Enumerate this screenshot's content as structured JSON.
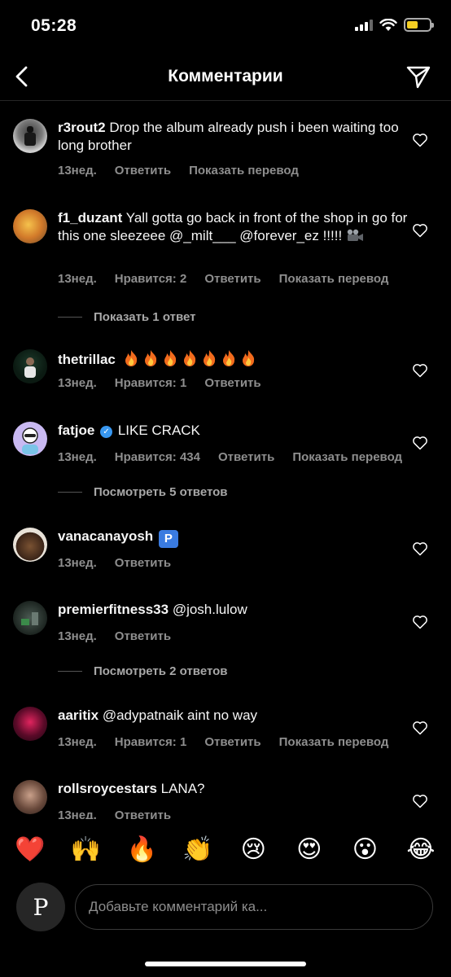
{
  "status": {
    "time": "05:28"
  },
  "header": {
    "title": "Комментарии"
  },
  "comments": [
    {
      "username": "r3rout2",
      "text": "Drop the album already push i been waiting too long brother",
      "time": "13нед.",
      "likes": "",
      "reply": "Ответить",
      "translate": "Показать перевод"
    },
    {
      "username": "f1_duzant",
      "text": "Yall gotta go back in front of the shop in go for this one sleezeee @_milt___ @forever_ez !!!!!",
      "time": "13нед.",
      "likes": "Нравится: 2",
      "reply": "Ответить",
      "translate": "Показать перевод",
      "replies_label": "Показать 1 ответ"
    },
    {
      "username": "thetrillac",
      "text": "",
      "time": "13нед.",
      "likes": "Нравится: 1",
      "reply": "Ответить",
      "translate": ""
    },
    {
      "username": "fatjoe",
      "text": "LIKE CRACK",
      "time": "13нед.",
      "likes": "Нравится: 434",
      "reply": "Ответить",
      "translate": "Показать перевод",
      "replies_label": "Посмотреть 5 ответов"
    },
    {
      "username": "vanacanayosh",
      "text": "",
      "time": "13нед.",
      "likes": "",
      "reply": "Ответить",
      "translate": ""
    },
    {
      "username": "premierfitness33",
      "text": "@josh.lulow",
      "time": "13нед.",
      "likes": "",
      "reply": "Ответить",
      "translate": "",
      "replies_label": "Посмотреть 2 ответов"
    },
    {
      "username": "aaritix",
      "text": "@adypatnaik aint no way",
      "time": "13нед.",
      "likes": "Нравится: 1",
      "reply": "Ответить",
      "translate": "Показать перевод"
    },
    {
      "username": "rollsroycestars",
      "text": "LANA?",
      "time": "13нед.",
      "likes": "",
      "reply": "Ответить",
      "translate": ""
    }
  ],
  "badges": {
    "parking": "P"
  },
  "emoji_bar": [
    "❤️",
    "🙌",
    "🔥",
    "👏",
    "😢",
    "😍",
    "😮",
    "😂"
  ],
  "composer": {
    "avatar_letter": "P",
    "placeholder": "Добавьте комментарий ка..."
  },
  "colors": {
    "background": "#000000",
    "muted_text": "#8e8e8e",
    "verified": "#3897f0",
    "divider": "#262626"
  }
}
